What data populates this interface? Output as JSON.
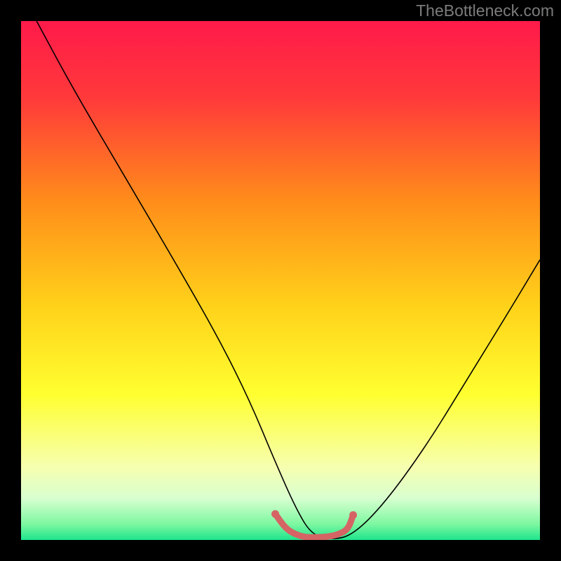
{
  "watermark": "TheBottleneck.com",
  "chart_data": {
    "type": "line",
    "title": "",
    "xlabel": "",
    "ylabel": "",
    "xlim": [
      0,
      100
    ],
    "ylim": [
      0,
      100
    ],
    "grid": false,
    "legend": false,
    "gradient_stops": [
      {
        "offset": 0.0,
        "color": "#ff1a4a"
      },
      {
        "offset": 0.15,
        "color": "#ff3a3a"
      },
      {
        "offset": 0.35,
        "color": "#ff8e1a"
      },
      {
        "offset": 0.55,
        "color": "#ffd21a"
      },
      {
        "offset": 0.72,
        "color": "#ffff30"
      },
      {
        "offset": 0.86,
        "color": "#f6ffb0"
      },
      {
        "offset": 0.92,
        "color": "#d8ffd0"
      },
      {
        "offset": 0.97,
        "color": "#7cf7a0"
      },
      {
        "offset": 1.0,
        "color": "#1de58c"
      }
    ],
    "series": [
      {
        "name": "bottleneck-curve",
        "color": "#000000",
        "x": [
          3,
          10,
          20,
          30,
          38,
          44,
          49,
          53,
          56,
          60,
          64,
          70,
          78,
          86,
          94,
          100
        ],
        "values": [
          100,
          87,
          70,
          53,
          39,
          27,
          15,
          6,
          1,
          0,
          1,
          7,
          18,
          31,
          44,
          54
        ]
      }
    ],
    "highlight": {
      "name": "low-bottleneck-band",
      "color": "#d56464",
      "x": [
        49,
        51,
        53,
        55,
        57,
        59,
        61,
        63,
        64
      ],
      "values": [
        5,
        2.2,
        1.0,
        0.5,
        0.5,
        0.6,
        1.0,
        2.0,
        4.8
      ],
      "marker_radius": 5.5
    }
  }
}
